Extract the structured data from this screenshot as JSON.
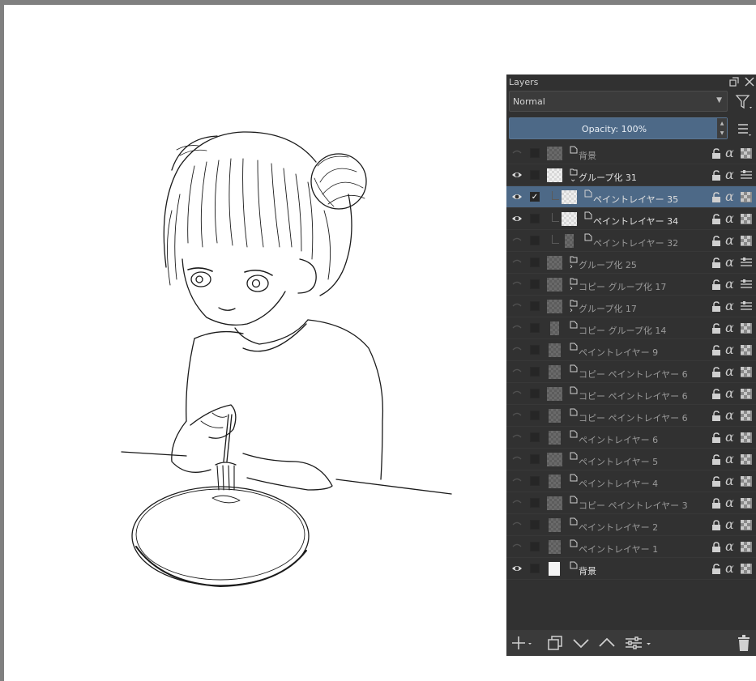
{
  "panel": {
    "title": "Layers",
    "blend_mode": "Normal",
    "opacity_label": "Opacity:  100%"
  },
  "layers": [
    {
      "name": "背景",
      "visible": false,
      "checked": false,
      "type": "paint",
      "indent": 0,
      "thumb": "dark",
      "locked": false,
      "dim": true
    },
    {
      "name": "グループ化 31",
      "visible": true,
      "checked": false,
      "type": "group-open",
      "indent": 0,
      "thumb": "light",
      "locked": false,
      "dim": false
    },
    {
      "name": "ペイントレイヤー 35",
      "visible": true,
      "checked": true,
      "type": "paint",
      "indent": 1,
      "thumb": "light",
      "locked": false,
      "dim": false,
      "selected": true
    },
    {
      "name": "ペイントレイヤー 34",
      "visible": true,
      "checked": false,
      "type": "paint",
      "indent": 1,
      "thumb": "light",
      "locked": false,
      "dim": false
    },
    {
      "name": "ペイントレイヤー 32",
      "visible": false,
      "checked": false,
      "type": "paint",
      "indent": 1,
      "thumb": "narrow",
      "locked": false,
      "dim": true
    },
    {
      "name": "グループ化 25",
      "visible": false,
      "checked": false,
      "type": "group",
      "indent": 0,
      "thumb": "dark",
      "locked": false,
      "dim": true
    },
    {
      "name": "コピー グループ化 17",
      "visible": false,
      "checked": false,
      "type": "group",
      "indent": 0,
      "thumb": "dark",
      "locked": false,
      "dim": true
    },
    {
      "name": "グループ化 17",
      "visible": false,
      "checked": false,
      "type": "group",
      "indent": 0,
      "thumb": "dark",
      "locked": false,
      "dim": true
    },
    {
      "name": "コピー グループ化 14",
      "visible": false,
      "checked": false,
      "type": "paint",
      "indent": 0,
      "thumb": "narrow",
      "locked": false,
      "dim": true
    },
    {
      "name": "ペイントレイヤー 9",
      "visible": false,
      "checked": false,
      "type": "paint",
      "indent": 0,
      "thumb": "mid",
      "locked": false,
      "dim": true
    },
    {
      "name": "コピー ペイントレイヤー 6",
      "visible": false,
      "checked": false,
      "type": "paint",
      "indent": 0,
      "thumb": "mid",
      "locked": false,
      "dim": true
    },
    {
      "name": "コピー ペイントレイヤー 6",
      "visible": false,
      "checked": false,
      "type": "paint",
      "indent": 0,
      "thumb": "dark",
      "locked": false,
      "dim": true
    },
    {
      "name": "コピー ペイントレイヤー 6",
      "visible": false,
      "checked": false,
      "type": "paint",
      "indent": 0,
      "thumb": "mid",
      "locked": false,
      "dim": true
    },
    {
      "name": "ペイントレイヤー 6",
      "visible": false,
      "checked": false,
      "type": "paint",
      "indent": 0,
      "thumb": "mid",
      "locked": false,
      "dim": true
    },
    {
      "name": "ペイントレイヤー 5",
      "visible": false,
      "checked": false,
      "type": "paint",
      "indent": 0,
      "thumb": "dark",
      "locked": false,
      "dim": true
    },
    {
      "name": "ペイントレイヤー 4",
      "visible": false,
      "checked": false,
      "type": "paint",
      "indent": 0,
      "thumb": "mid",
      "locked": false,
      "dim": true
    },
    {
      "name": "コピー ペイントレイヤー 3",
      "visible": false,
      "checked": false,
      "type": "paint",
      "indent": 0,
      "thumb": "dark",
      "locked": true,
      "dim": true
    },
    {
      "name": "ペイントレイヤー 2",
      "visible": false,
      "checked": false,
      "type": "paint",
      "indent": 0,
      "thumb": "mid",
      "locked": true,
      "dim": true
    },
    {
      "name": "ペイントレイヤー 1",
      "visible": false,
      "checked": false,
      "type": "paint",
      "indent": 0,
      "thumb": "mid",
      "locked": true,
      "dim": true
    },
    {
      "name": "背景",
      "visible": true,
      "checked": false,
      "type": "paint",
      "indent": 0,
      "thumb": "white",
      "locked": false,
      "dim": false
    }
  ],
  "colors": {
    "panel_bg": "#313131",
    "selection": "#4d6987",
    "canvas": "#ffffff",
    "frame": "#808080"
  }
}
